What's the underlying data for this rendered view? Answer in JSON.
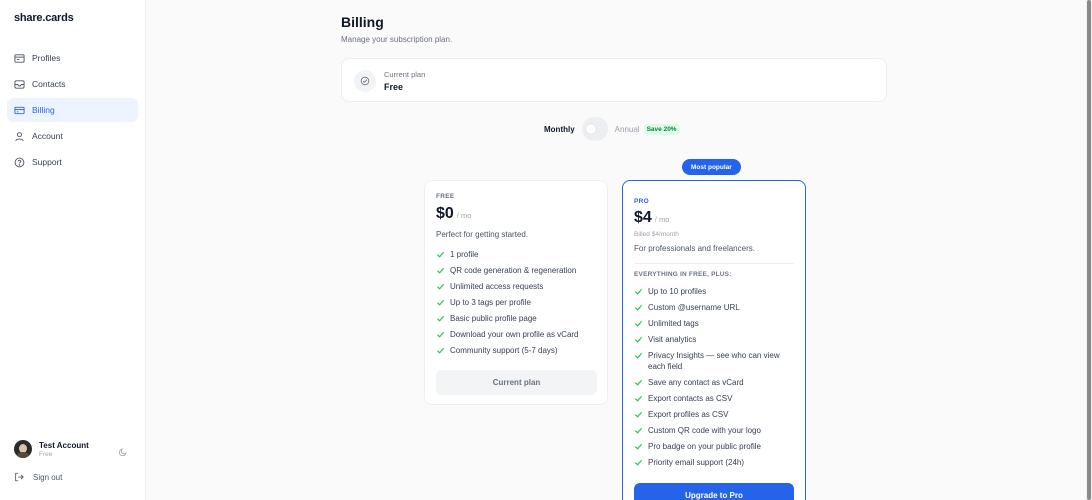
{
  "app": {
    "logo": "share.cards"
  },
  "sidebar": {
    "items": [
      {
        "label": "Profiles",
        "icon": "id-card-icon"
      },
      {
        "label": "Contacts",
        "icon": "inbox-icon"
      },
      {
        "label": "Billing",
        "icon": "credit-card-icon",
        "active": true
      },
      {
        "label": "Account",
        "icon": "user-icon"
      },
      {
        "label": "Support",
        "icon": "help-circle-icon"
      }
    ],
    "user": {
      "name": "Test Account",
      "plan": "Free"
    },
    "signout_label": "Sign out"
  },
  "main": {
    "title": "Billing",
    "subtitle": "Manage your subscription plan.",
    "current_plan": {
      "label": "Current plan",
      "value": "Free"
    },
    "cycle": {
      "monthly": "Monthly",
      "annual": "Annual",
      "save": "Save 20%",
      "selected": "Monthly"
    }
  },
  "plans": {
    "free": {
      "tier": "FREE",
      "price": "$0",
      "period": "/ mo",
      "tagline": "Perfect for getting started.",
      "features": [
        "1 profile",
        "QR code generation & regeneration",
        "Unlimited access requests",
        "Up to 3 tags per profile",
        "Basic public profile page",
        "Download your own profile as vCard",
        "Community support (5-7 days)"
      ],
      "button": "Current plan"
    },
    "pro": {
      "badge": "Most popular",
      "tier": "PRO",
      "price": "$4",
      "period": "/ mo",
      "billed": "Billed $4/month",
      "tagline": "For professionals and freelancers.",
      "plus_label": "EVERYTHING IN FREE, PLUS:",
      "features": [
        "Up to 10 profiles",
        "Custom @username URL",
        "Unlimited tags",
        "Visit analytics",
        "Privacy Insights — see who can view each field",
        "Save any contact as vCard",
        "Export contacts as CSV",
        "Export profiles as CSV",
        "Custom QR code with your logo",
        "Pro badge on your public profile",
        "Priority email support (24h)"
      ],
      "button": "Upgrade to Pro"
    }
  },
  "colors": {
    "accent": "#2563eb",
    "check": "#22c55e",
    "save_badge_bg": "#dcfce7"
  }
}
